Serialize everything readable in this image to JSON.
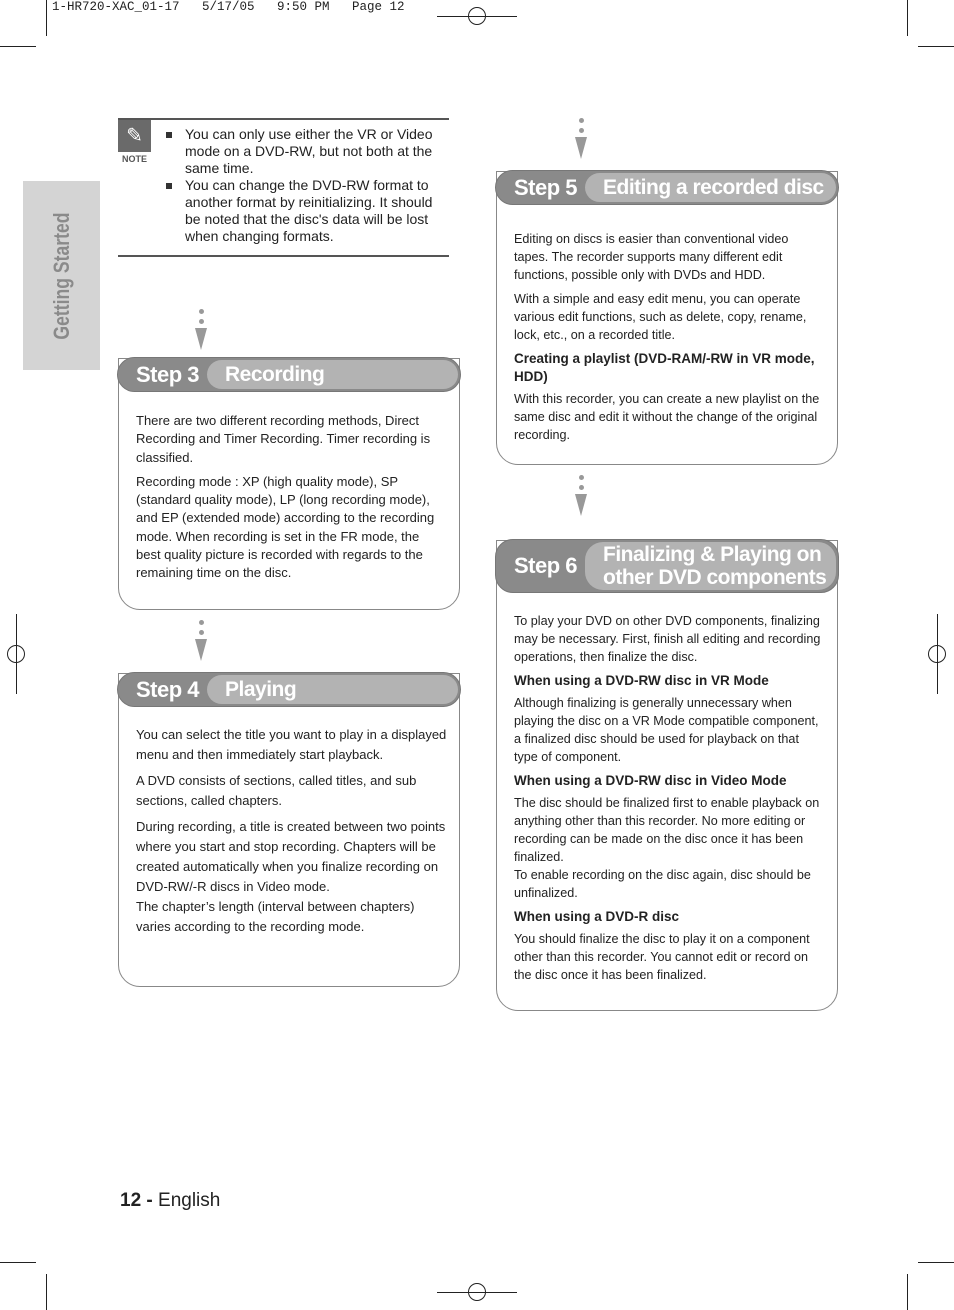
{
  "slug": "1-HR720-XAC_01-17   5/17/05   9:50 PM   Page 12",
  "side_tab": "Getting Started",
  "note": {
    "icon": "pencil-icon",
    "label": "NOTE",
    "items": [
      "You can only use either the VR or Video mode on a DVD-RW, but not both at the same time.",
      "You can change the DVD-RW format to another format by reinitializing. It should be noted that the disc's data will be lost when changing formats."
    ]
  },
  "steps": [
    {
      "num": "Step 3",
      "title": "Recording",
      "paragraphs": [
        "There are two different recording methods, Direct Recording and Timer Recording. Timer recording is classified.",
        "Recording mode : XP (high quality mode), SP (standard quality mode), LP (long recording mode), and EP (extended mode) according to the recording mode. When recording is set in the FR mode, the best quality picture is recorded with regards to the remaining time on the disc."
      ]
    },
    {
      "num": "Step 4",
      "title": "Playing",
      "paragraphs": [
        "You can select the title you want to play in a displayed menu and then immediately start playback.",
        "A DVD consists of sections, called titles, and sub sections, called chapters.",
        "During recording, a title is created between two points where you start and stop recording. Chapters will be created automatically when you finalize recording on DVD-RW/-R discs in Video mode.",
        "The chapter’s length (interval between chapters) varies according to the recording mode."
      ]
    },
    {
      "num": "Step 5",
      "title": "Editing a recorded disc",
      "paragraphs": [
        "Editing on discs is easier than conventional video tapes. The recorder supports many different edit functions, possible only with DVDs and HDD.",
        "With a simple and easy edit menu, you can operate various edit functions, such as delete, copy, rename, lock, etc., on a recorded title.",
        "Creating a playlist (DVD-RAM/-RW in VR mode, HDD)",
        "With this recorder, you can create a new playlist on the same disc and edit it without the change of the original recording."
      ]
    },
    {
      "num": "Step 6",
      "title_line1": "Finalizing & Playing on",
      "title_line2": "other DVD components",
      "paragraphs": [
        "To play your DVD on other DVD components, finalizing may be necessary. First, finish all editing and recording operations, then finalize the disc.",
        "When using a DVD-RW disc in VR Mode",
        "Although finalizing is generally unnecessary when playing the disc on a VR Mode compatible component, a finalized disc should be used for playback on that type of component.",
        "When using a DVD-RW disc in Video Mode",
        "The disc should be finalized first to enable playback on anything other than this recorder. No more editing or recording can be made on the disc once it has been finalized.",
        "To enable recording on the disc again, disc should be unfinalized.",
        "When using a DVD-R disc",
        "You should finalize the disc to play it on a component other than this recorder. You cannot edit or record on the disc once it has been finalized."
      ]
    }
  ],
  "footer": {
    "page": "12 -",
    "lang": "English"
  }
}
